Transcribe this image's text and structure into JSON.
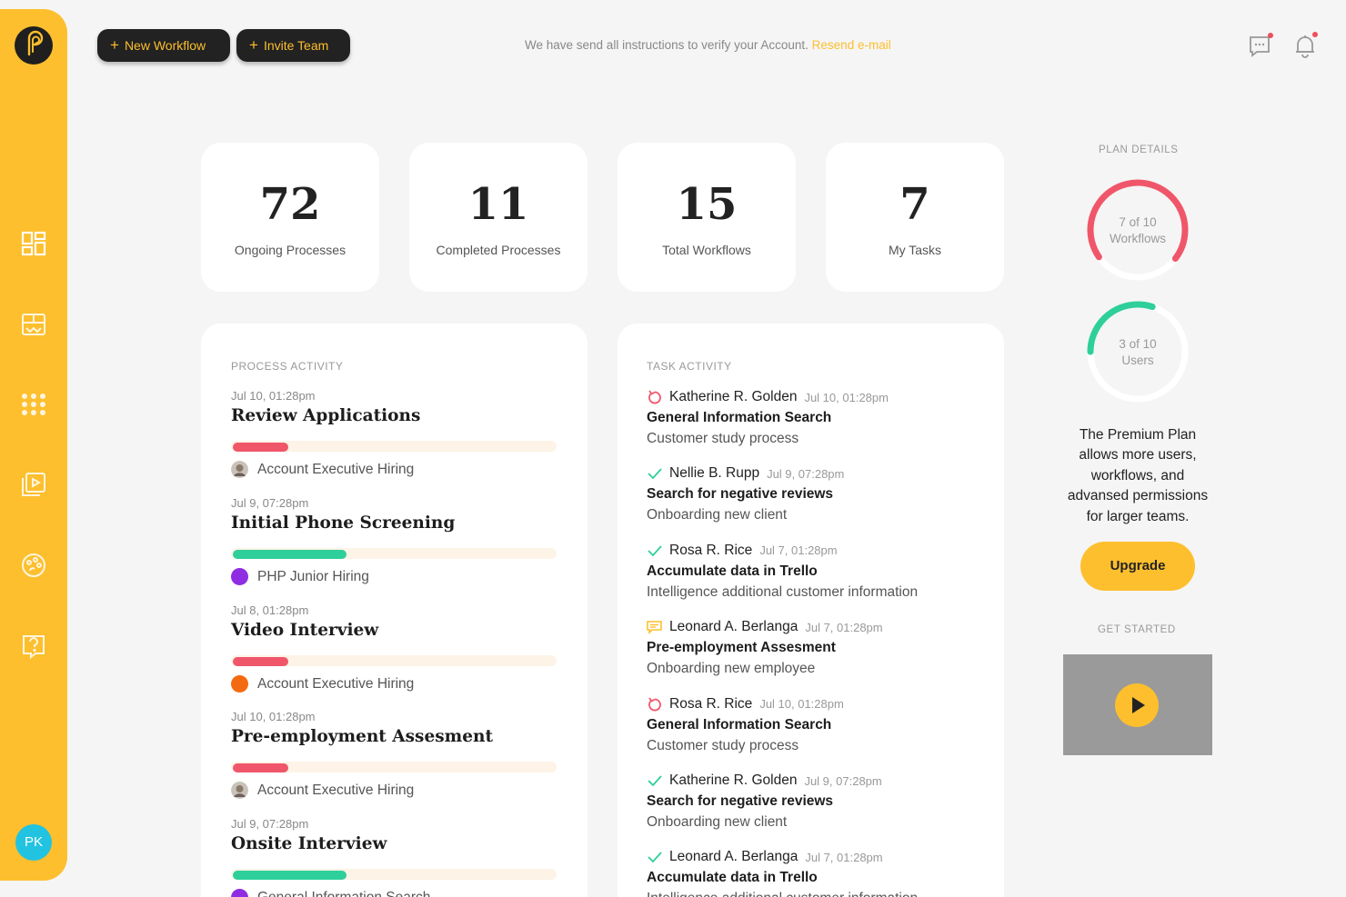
{
  "topbar": {
    "new_workflow": "New Workflow",
    "invite_team": "Invite Team",
    "notice": "We have send all instructions to verify your Account.",
    "resend": "Resend e-mail"
  },
  "sidebar": {
    "icons": [
      "logo-icon",
      "dashboard-icon",
      "boards-icon",
      "apps-grid-icon",
      "media-icon",
      "palette-icon",
      "help-icon"
    ],
    "user_initials": "PK"
  },
  "stats": [
    {
      "value": "72",
      "label": "Ongoing Processes"
    },
    {
      "value": "11",
      "label": "Completed Processes"
    },
    {
      "value": "15",
      "label": "Total Workflows"
    },
    {
      "value": "7",
      "label": "My Tasks"
    }
  ],
  "process_activity": {
    "title": "PROCESS ACTIVITY",
    "items": [
      {
        "date": "Jul 10, 01:28pm",
        "title": "Review Applications",
        "progress": 0.17,
        "color": "#f0566a",
        "subtitle": "Account Executive Hiring",
        "avatar": "photo"
      },
      {
        "date": "Jul 9, 07:28pm",
        "title": "Initial Phone Screening",
        "progress": 0.35,
        "color": "#2ecf9a",
        "subtitle": "PHP Junior Hiring",
        "avatar": "#8e2de2"
      },
      {
        "date": "Jul 8, 01:28pm",
        "title": "Video Interview",
        "progress": 0.17,
        "color": "#f0566a",
        "subtitle": "Account Executive Hiring",
        "avatar": "#f36a10"
      },
      {
        "date": "Jul 10, 01:28pm",
        "title": "Pre-employment Assesment",
        "progress": 0.17,
        "color": "#f0566a",
        "subtitle": "Account Executive Hiring",
        "avatar": "photo"
      },
      {
        "date": "Jul 9, 07:28pm",
        "title": "Onsite Interview",
        "progress": 0.35,
        "color": "#2ecf9a",
        "subtitle": "General Information Search",
        "avatar": "#8e2de2"
      }
    ]
  },
  "task_activity": {
    "title": "TASK ACTIVITY",
    "items": [
      {
        "icon": "refresh",
        "person": "Katherine R. Golden",
        "when": "Jul 10, 01:28pm",
        "task": "General Information Search",
        "process": "Customer study process"
      },
      {
        "icon": "check",
        "person": "Nellie B. Rupp",
        "when": "Jul 9, 07:28pm",
        "task": "Search for negative reviews",
        "process": "Onboarding new client"
      },
      {
        "icon": "check",
        "person": "Rosa R. Rice",
        "when": "Jul 7, 01:28pm",
        "task": "Accumulate data in Trello",
        "process": "Intelligence additional customer information"
      },
      {
        "icon": "comment",
        "person": "Leonard A. Berlanga",
        "when": "Jul 7, 01:28pm",
        "task": "Pre-employment Assesment",
        "process": "Onboarding new employee"
      },
      {
        "icon": "refresh",
        "person": "Rosa R. Rice",
        "when": "Jul 10, 01:28pm",
        "task": "General Information Search",
        "process": "Customer study process"
      },
      {
        "icon": "check",
        "person": "Katherine R. Golden",
        "when": "Jul 9, 07:28pm",
        "task": "Search for negative reviews",
        "process": "Onboarding new client"
      },
      {
        "icon": "check",
        "person": "Leonard A. Berlanga",
        "when": "Jul 7, 01:28pm",
        "task": "Accumulate data in Trello",
        "process": "Intelligence additional customer information"
      }
    ]
  },
  "plan": {
    "title": "PLAN DETAILS",
    "workflows": {
      "line1": "7 of 10",
      "line2": "Workflows",
      "used": 7,
      "total": 10,
      "color": "#f0566a"
    },
    "users": {
      "line1": "3 of 10",
      "line2": "Users",
      "used": 3,
      "total": 10,
      "color": "#2ecf9a"
    },
    "description": "The Premium Plan allows more users, workflows, and advansed permissions for larger teams.",
    "upgrade": "Upgrade"
  },
  "get_started": {
    "title": "GET STARTED"
  },
  "colors": {
    "accent": "#fdbf2d",
    "dark": "#222222",
    "red": "#f0566a",
    "green": "#2ecf9a"
  }
}
